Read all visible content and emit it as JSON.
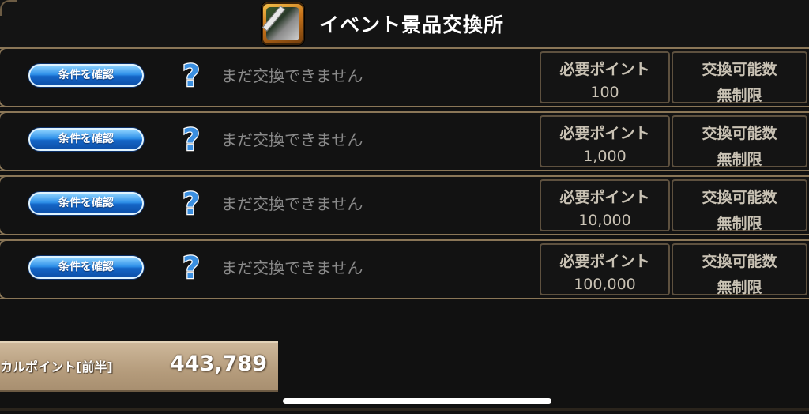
{
  "header": {
    "title": "イベント景品交換所",
    "icon": "event-exchange-icon"
  },
  "rows": [
    {
      "button_label": "条件を確認",
      "icon": "question-mark-icon",
      "status": "まだ交換できません",
      "points_label": "必要ポイント",
      "points_value": "100",
      "limit_label": "交換可能数",
      "limit_value": "無制限"
    },
    {
      "button_label": "条件を確認",
      "icon": "question-mark-icon",
      "status": "まだ交換できません",
      "points_label": "必要ポイント",
      "points_value": "1,000",
      "limit_label": "交換可能数",
      "limit_value": "無制限"
    },
    {
      "button_label": "条件を確認",
      "icon": "question-mark-icon",
      "status": "まだ交換できません",
      "points_label": "必要ポイント",
      "points_value": "10,000",
      "limit_label": "交換可能数",
      "limit_value": "無制限"
    },
    {
      "button_label": "条件を確認",
      "icon": "question-mark-icon",
      "status": "まだ交換できません",
      "points_label": "必要ポイント",
      "points_value": "100,000",
      "limit_label": "交換可能数",
      "limit_value": "無制限"
    }
  ],
  "points_display": {
    "label": "カルポイント[前半]",
    "value": "443,789"
  },
  "colors": {
    "button_blue": "#1e7ad6",
    "frame_bronze": "#8a7657",
    "background": "#111111"
  }
}
